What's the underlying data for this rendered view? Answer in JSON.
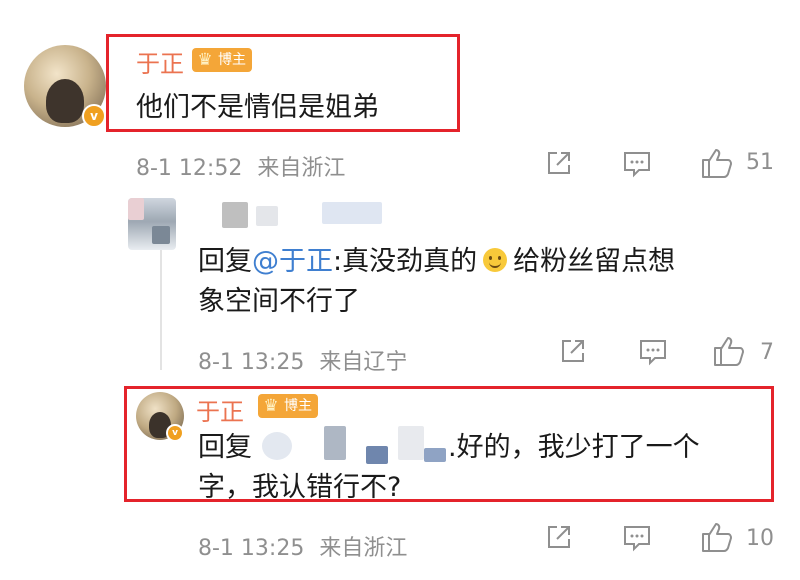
{
  "comments": [
    {
      "author": "于正",
      "badge": "博主",
      "text": "他们不是情侣是姐弟",
      "time": "8-1 12:52",
      "location": "来自浙江",
      "likes": "51"
    },
    {
      "reply_prefix": "回复",
      "mention": "@于正",
      "text_line1_after_mention": ":真没劲真的",
      "text_line1_after_emoji": "给粉丝留点想",
      "text_line2": "象空间不行了",
      "time": "8-1 13:25",
      "location": "来自辽宁",
      "likes": "7"
    },
    {
      "author": "于正",
      "badge": "博主",
      "reply_prefix": "回复",
      "text_line1_after_blur": ".好的，我少打了一个",
      "text_line2": "字，我认错行不?",
      "time": "8-1 13:25",
      "location": "来自浙江",
      "likes": "10"
    }
  ],
  "colors": {
    "name": "#eb7350",
    "mention": "#3f7fd0",
    "highlight_box": "#e4232b",
    "meta": "#8f8f8f"
  },
  "icons": [
    "share-icon",
    "comment-icon",
    "like-icon",
    "verified-icon",
    "crown-icon",
    "smile-emoji-icon"
  ]
}
